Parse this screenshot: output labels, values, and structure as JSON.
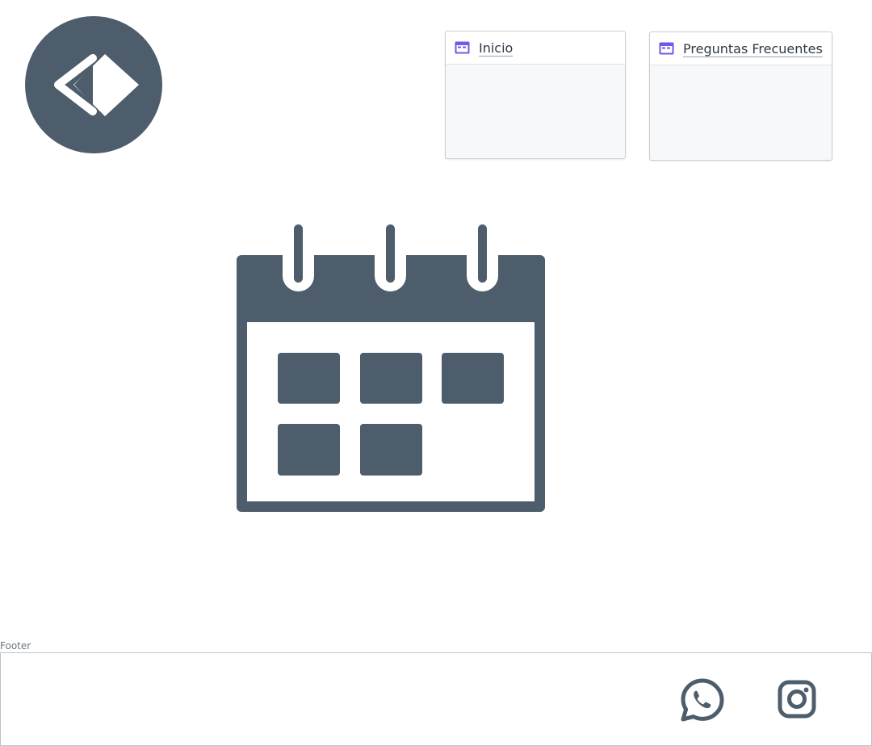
{
  "header": {
    "logo_icon": "chevron-diamond-logo",
    "nav": [
      {
        "label": "Inicio",
        "icon": "page-icon"
      },
      {
        "label": "Preguntas Frecuentes",
        "icon": "page-icon"
      }
    ]
  },
  "main": {
    "illustration": "calendar-icon"
  },
  "footer": {
    "caption": "Footer",
    "social": [
      {
        "name": "whatsapp-icon"
      },
      {
        "name": "instagram-icon"
      }
    ]
  },
  "colors": {
    "primary": "#4d5d6b",
    "accent": "#6c5ce7",
    "card_bg": "#f7f8fa",
    "border": "#c9cfd6"
  }
}
